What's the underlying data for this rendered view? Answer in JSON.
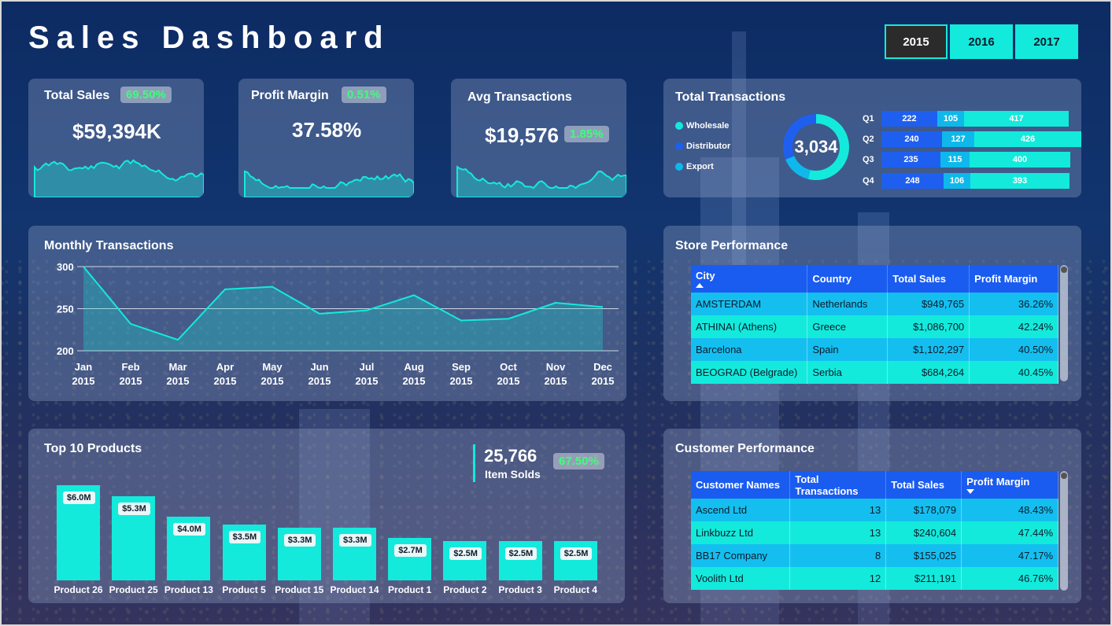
{
  "title": "Sales Dashboard",
  "years": [
    {
      "label": "2015",
      "active": true
    },
    {
      "label": "2016",
      "active": false
    },
    {
      "label": "2017",
      "active": false
    }
  ],
  "kpis": {
    "total_sales": {
      "title": "Total Sales",
      "value": "$59,394K",
      "change": "69.50%"
    },
    "profit_margin": {
      "title": "Profit Margin",
      "value": "37.58%",
      "change": "0.51%"
    },
    "avg_transactions": {
      "title": "Avg Transactions",
      "value": "$19,576",
      "change": "1.85%"
    }
  },
  "total_transactions": {
    "title": "Total Transactions",
    "total": "3,034",
    "legend": [
      {
        "label": "Wholesale",
        "color": "#13eadc"
      },
      {
        "label": "Distributor",
        "color": "#1f5ff0"
      },
      {
        "label": "Export",
        "color": "#0fb8ea"
      }
    ],
    "quarters": [
      {
        "label": "Q1",
        "wholesale": 222,
        "distributor": 105,
        "export": 417
      },
      {
        "label": "Q2",
        "wholesale": 240,
        "distributor": 127,
        "export": 426
      },
      {
        "label": "Q3",
        "wholesale": 235,
        "distributor": 115,
        "export": 400
      },
      {
        "label": "Q4",
        "wholesale": 248,
        "distributor": 106,
        "export": 393
      }
    ]
  },
  "monthly": {
    "title": "Monthly Transactions",
    "chart_data": {
      "type": "area",
      "categories": [
        "Jan 2015",
        "Feb 2015",
        "Mar 2015",
        "Apr 2015",
        "May 2015",
        "Jun 2015",
        "Jul 2015",
        "Aug 2015",
        "Sep 2015",
        "Oct 2015",
        "Nov 2015",
        "Dec 2015"
      ],
      "month_labels": [
        "Jan",
        "Feb",
        "Mar",
        "Apr",
        "May",
        "Jun",
        "Jul",
        "Aug",
        "Sep",
        "Oct",
        "Nov",
        "Dec"
      ],
      "year_label": "2015",
      "values": [
        300,
        232,
        213,
        273,
        276,
        244,
        248,
        266,
        236,
        238,
        257,
        252
      ],
      "yticks": [
        300,
        250,
        200
      ],
      "ylim": [
        200,
        300
      ],
      "grid": true
    }
  },
  "store": {
    "title": "Store Performance",
    "columns": [
      "City",
      "Country",
      "Total Sales",
      "Profit Margin"
    ],
    "rows": [
      [
        "AMSTERDAM",
        "Netherlands",
        "$949,765",
        "36.26%"
      ],
      [
        "ATHINAI (Athens)",
        "Greece",
        "$1,086,700",
        "42.24%"
      ],
      [
        "Barcelona",
        "Spain",
        "$1,102,297",
        "40.50%"
      ],
      [
        "BEOGRAD (Belgrade)",
        "Serbia",
        "$684,264",
        "40.45%"
      ]
    ]
  },
  "products": {
    "title": "Top 10 Products",
    "items_sold": "25,766",
    "items_sold_label": "Item Solds",
    "items_change": "67.50%",
    "chart_data": {
      "type": "bar",
      "categories": [
        "Product 26",
        "Product 25",
        "Product 13",
        "Product 5",
        "Product 15",
        "Product 14",
        "Product 1",
        "Product 2",
        "Product 3",
        "Product 4"
      ],
      "values": [
        6.0,
        5.3,
        4.0,
        3.5,
        3.3,
        3.3,
        2.7,
        2.5,
        2.5,
        2.5
      ],
      "labels": [
        "$6.0M",
        "$5.3M",
        "$4.0M",
        "$3.5M",
        "$3.3M",
        "$3.3M",
        "$2.7M",
        "$2.5M",
        "$2.5M",
        "$2.5M"
      ]
    }
  },
  "customer": {
    "title": "Customer Performance",
    "columns": [
      "Customer Names",
      "Total Transactions",
      "Total Sales",
      "Profit Margin"
    ],
    "rows": [
      [
        "Ascend Ltd",
        "13",
        "$178,079",
        "48.43%"
      ],
      [
        "Linkbuzz Ltd",
        "13",
        "$240,604",
        "47.44%"
      ],
      [
        "BB17 Company",
        "8",
        "$155,025",
        "47.17%"
      ],
      [
        "Voolith Ltd",
        "12",
        "$211,191",
        "46.76%"
      ]
    ]
  }
}
